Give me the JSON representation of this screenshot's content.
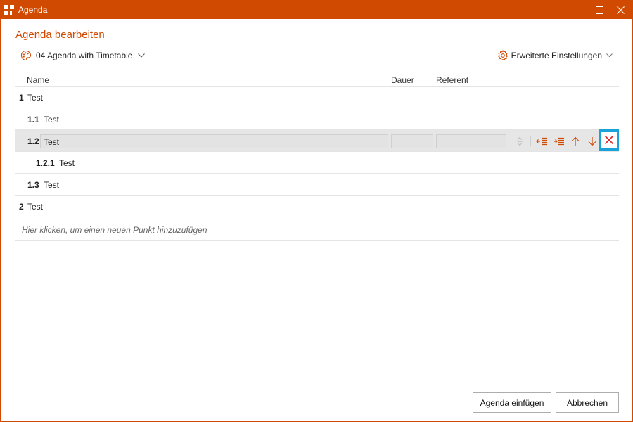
{
  "window": {
    "title": "Agenda",
    "accent_color": "#d04a02",
    "app_icon": "powerpoint-addin-icon",
    "maximize_icon": "maximize-icon",
    "close_icon": "close-icon"
  },
  "header": {
    "title": "Agenda bearbeiten",
    "template": {
      "icon": "palette-icon",
      "label": "04 Agenda with Timetable"
    },
    "settings": {
      "icon": "gear-icon",
      "label": "Erweiterte Einstellungen"
    }
  },
  "table": {
    "columns": {
      "name": "Name",
      "dauer": "Dauer",
      "referent": "Referent"
    },
    "rows": [
      {
        "number": "1",
        "text": "Test",
        "level": 1
      },
      {
        "number": "1.1",
        "text": "Test",
        "level": 2
      },
      {
        "number": "1.2",
        "text": "Test",
        "level": 2,
        "selected": true
      },
      {
        "number": "1.2.1",
        "text": "Test",
        "level": 3
      },
      {
        "number": "1.3",
        "text": "Test",
        "level": 2
      },
      {
        "number": "2",
        "text": "Test",
        "level": 1
      }
    ],
    "row_tools": [
      "drag-handle-icon",
      "outdent-icon",
      "indent-icon",
      "move-up-icon",
      "move-down-icon",
      "delete-icon"
    ],
    "add_hint": "Hier klicken, um einen neuen Punkt hinzuzufügen"
  },
  "footer": {
    "insert_label": "Agenda einfügen",
    "cancel_label": "Abbrechen"
  },
  "colors": {
    "accent": "#d04a02",
    "delete": "#e0252b",
    "highlight": "#1aa3d9"
  }
}
